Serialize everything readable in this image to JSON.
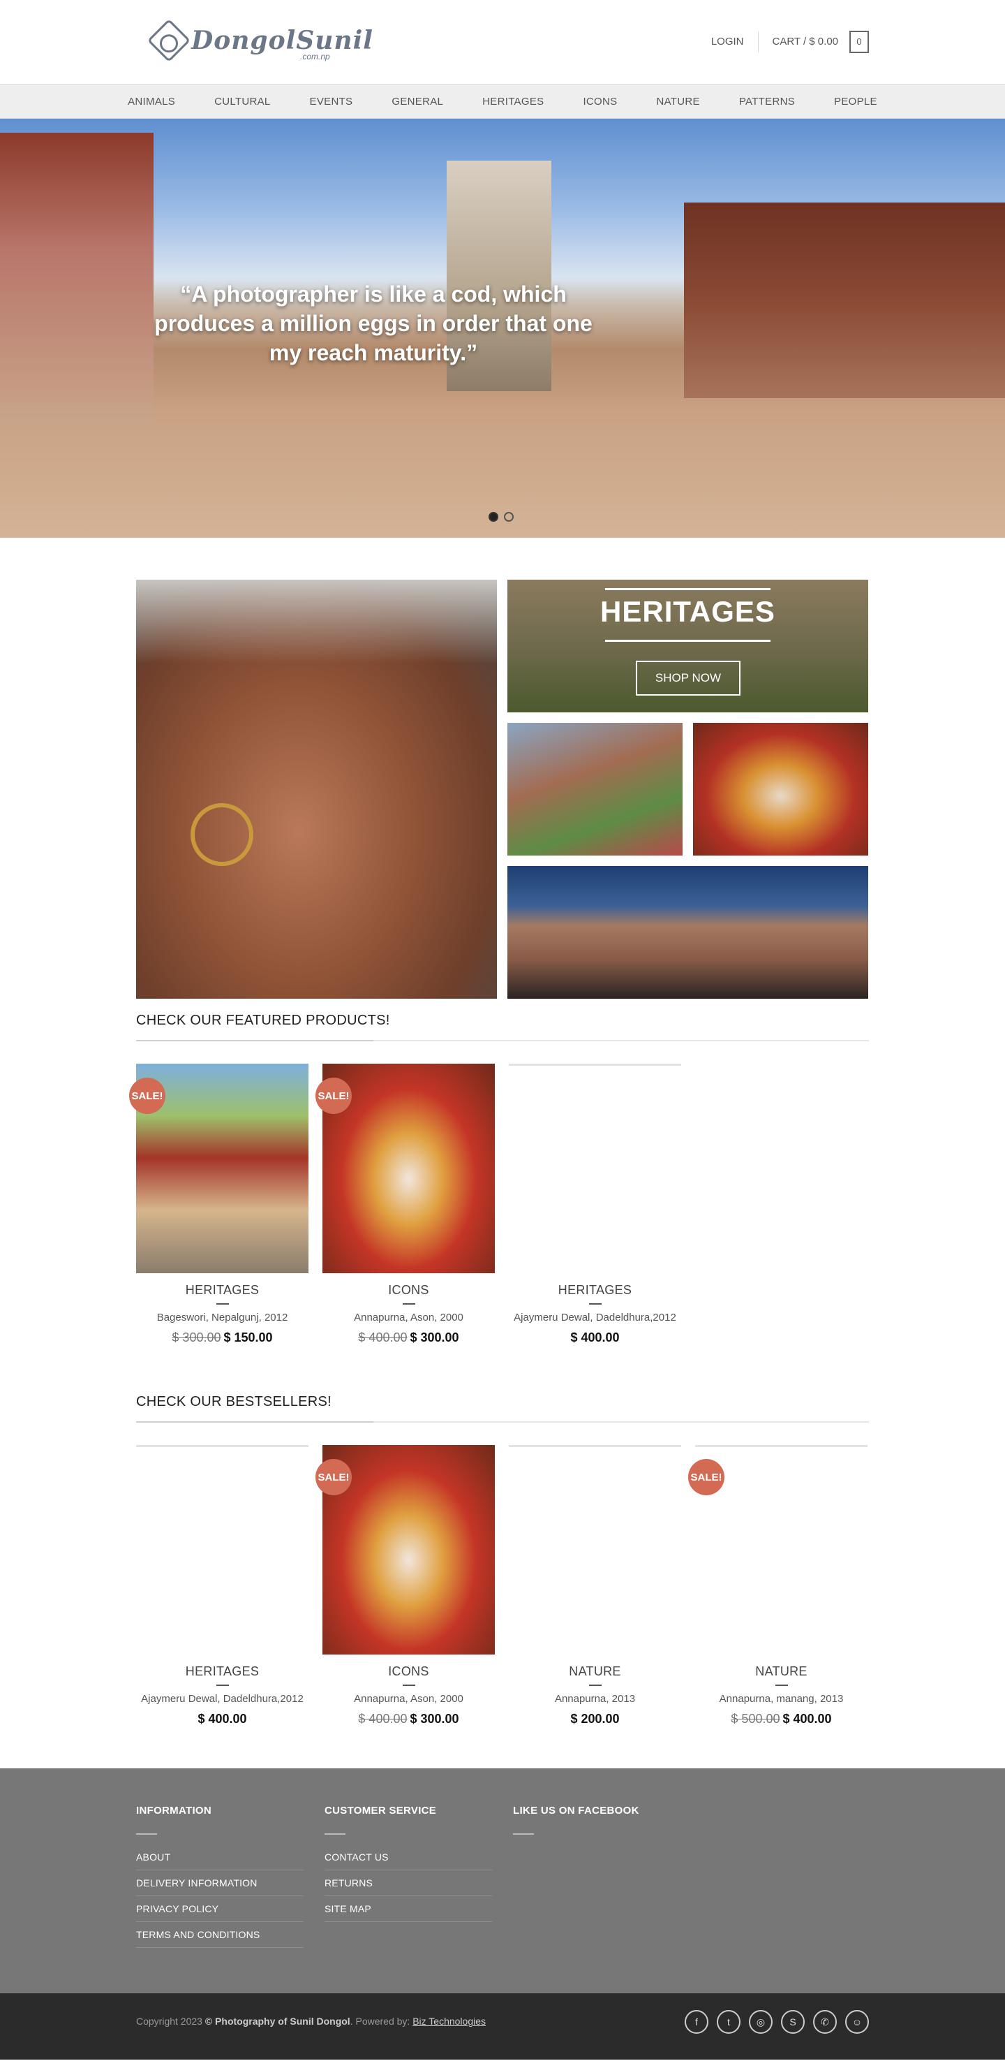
{
  "header": {
    "logo_text": "DongolSunil",
    "logo_sub": ".com.np",
    "login": "LOGIN",
    "cart": "CART / $ 0.00",
    "cart_count": "0"
  },
  "nav": {
    "items": [
      "ANIMALS",
      "CULTURAL",
      "EVENTS",
      "GENERAL",
      "HERITAGES",
      "ICONS",
      "NATURE",
      "PATTERNS",
      "PEOPLE"
    ]
  },
  "hero": {
    "quote": "“A photographer is like a cod, which produces a million eggs in order that one my reach maturity.”",
    "slide_count": 2,
    "active_slide": 1
  },
  "banners": {
    "heritage_title": "HERITAGES",
    "shop_button": "SHOP NOW"
  },
  "featured": {
    "title": "CHECK OUR FEATURED PRODUCTS!",
    "products": [
      {
        "sale": "SALE!",
        "category": "HERITAGES",
        "name": "Bageswori, Nepalgunj, 2012",
        "old_price": "$ 300.00",
        "price": "$ 150.00"
      },
      {
        "sale": "SALE!",
        "category": "ICONS",
        "name": "Annapurna, Ason, 2000",
        "old_price": "$ 400.00",
        "price": "$ 300.00"
      },
      {
        "sale": "",
        "category": "HERITAGES",
        "name": "Ajaymeru Dewal, Dadeldhura,2012",
        "old_price": "",
        "price": "$ 400.00"
      }
    ]
  },
  "bestsellers": {
    "title": "CHECK OUR BESTSELLERS!",
    "products": [
      {
        "sale": "",
        "category": "HERITAGES",
        "name": "Ajaymeru Dewal, Dadeldhura,2012",
        "old_price": "",
        "price": "$ 400.00"
      },
      {
        "sale": "SALE!",
        "category": "ICONS",
        "name": "Annapurna, Ason, 2000",
        "old_price": "$ 400.00",
        "price": "$ 300.00"
      },
      {
        "sale": "",
        "category": "NATURE",
        "name": "Annapurna, 2013",
        "old_price": "",
        "price": "$ 200.00"
      },
      {
        "sale": "SALE!",
        "category": "NATURE",
        "name": "Annapurna, manang, 2013",
        "old_price": "$ 500.00",
        "price": "$ 400.00"
      }
    ]
  },
  "footer": {
    "information": {
      "title": "INFORMATION",
      "links": [
        "ABOUT",
        "DELIVERY INFORMATION",
        "PRIVACY POLICY",
        "TERMS AND CONDITIONS"
      ]
    },
    "customer_service": {
      "title": "CUSTOMER SERVICE",
      "links": [
        "CONTACT US",
        "RETURNS",
        "SITE MAP"
      ]
    },
    "facebook": {
      "title": "LIKE US ON FACEBOOK"
    },
    "copy_prefix": "Copyright 2023",
    "copy_brand": "© Photography of Sunil Dongol",
    "powered_by": ". Powered by:",
    "powered_link": "Biz Technologies",
    "socials": [
      "facebook-icon",
      "twitter-icon",
      "instagram-icon",
      "skype-icon",
      "viber-icon",
      "wechat-icon"
    ],
    "social_glyphs": [
      "f",
      "t",
      "◎",
      "S",
      "✆",
      "☺"
    ]
  }
}
